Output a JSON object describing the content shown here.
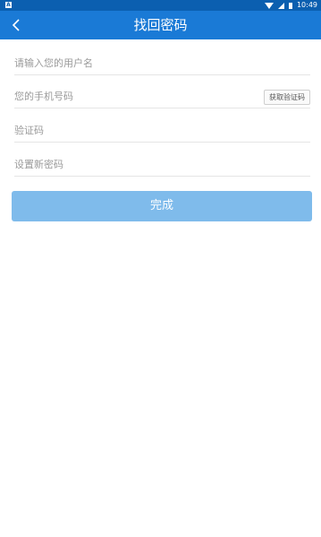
{
  "status_bar": {
    "time": "10:49",
    "left_icon": "A",
    "icons": [
      "notification-icon",
      "wifi-icon",
      "signal-icon",
      "battery-icon"
    ]
  },
  "header": {
    "title": "找回密码",
    "back_icon": "chevron-left-icon",
    "background": "#1a7ad6"
  },
  "form": {
    "username_placeholder": "请输入您的用户名",
    "phone_placeholder": "您的手机号码",
    "get_code_label": "获取验证码",
    "code_placeholder": "验证码",
    "new_password_placeholder": "设置新密码",
    "submit_label": "完成",
    "submit_color": "#7fbbeb"
  }
}
